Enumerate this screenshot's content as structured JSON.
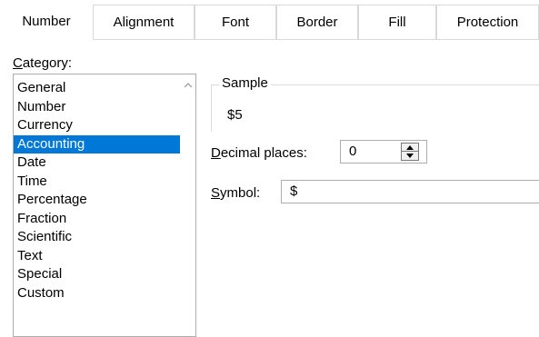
{
  "tabs": [
    {
      "label": "Number",
      "active": true
    },
    {
      "label": "Alignment",
      "active": false
    },
    {
      "label": "Font",
      "active": false
    },
    {
      "label": "Border",
      "active": false
    },
    {
      "label": "Fill",
      "active": false
    },
    {
      "label": "Protection",
      "active": false
    }
  ],
  "category": {
    "label_first": "C",
    "label_rest": "ategory:",
    "items": [
      "General",
      "Number",
      "Currency",
      "Accounting",
      "Date",
      "Time",
      "Percentage",
      "Fraction",
      "Scientific",
      "Text",
      "Special",
      "Custom"
    ],
    "selected": "Accounting"
  },
  "sample": {
    "legend": "Sample",
    "value": "$5"
  },
  "decimal_places": {
    "label_first": "D",
    "label_rest": "ecimal places:",
    "value": "0"
  },
  "symbol": {
    "label_first": "S",
    "label_rest": "ymbol:",
    "value": "$"
  },
  "icons": {
    "scroll_up": "chevron-up-icon",
    "spin_up": "triangle-up-icon",
    "spin_down": "triangle-down-icon"
  },
  "colors": {
    "selection": "#0078d7",
    "border": "#adadad"
  }
}
